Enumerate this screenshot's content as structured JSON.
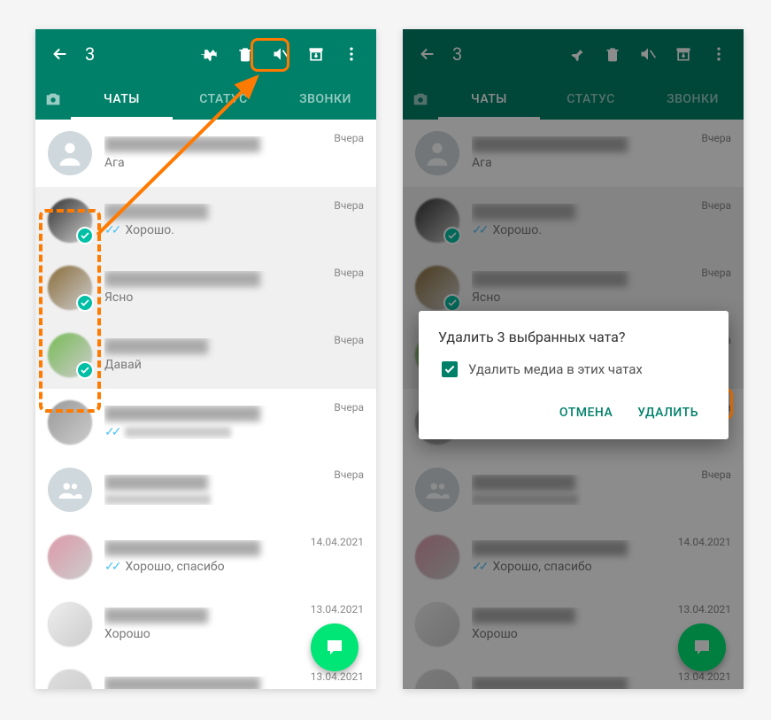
{
  "header": {
    "count": "3"
  },
  "tabs": {
    "chats": "ЧАТЫ",
    "status": "СТАТУС",
    "calls": "ЗВОНКИ"
  },
  "chats": [
    {
      "msg": "Ага",
      "time": "Вчера",
      "ticks": false,
      "selected": false,
      "avatar": "default"
    },
    {
      "msg": "Хорошо.",
      "time": "Вчера",
      "ticks": true,
      "selected": true,
      "avatar": "img1"
    },
    {
      "msg": "Ясно",
      "time": "Вчера",
      "ticks": false,
      "selected": true,
      "avatar": "img2"
    },
    {
      "msg": "Давай",
      "time": "Вчера",
      "ticks": false,
      "selected": true,
      "avatar": "img3"
    },
    {
      "msg": "",
      "time": "Вчера",
      "ticks": true,
      "selected": false,
      "avatar": "img4",
      "blurmsg": true
    },
    {
      "msg": "",
      "time": "Вчера",
      "ticks": false,
      "selected": false,
      "avatar": "group",
      "blurmsg": true
    },
    {
      "msg": "Хорошо, спасибо",
      "time": "14.04.2021",
      "ticks": true,
      "selected": false,
      "avatar": "img5"
    },
    {
      "msg": "Хорошо",
      "time": "13.04.2021",
      "ticks": false,
      "selected": false,
      "avatar": "img6"
    },
    {
      "msg": "",
      "time": "13.04.2021",
      "ticks": false,
      "selected": false,
      "avatar": "img7",
      "blurmsg": true
    }
  ],
  "dialog": {
    "title": "Удалить 3 выбранных чата?",
    "checkbox_label": "Удалить медиа в этих чатах",
    "cancel": "ОТМЕНА",
    "delete": "УДАЛИТЬ"
  }
}
